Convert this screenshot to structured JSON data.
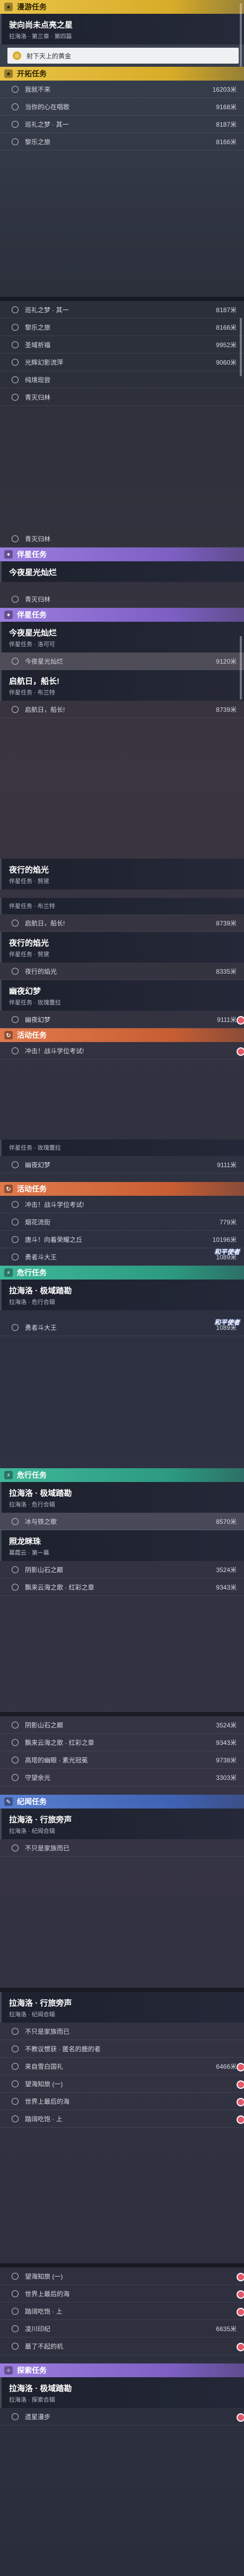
{
  "shot1": {
    "hdr1": "漫游任务",
    "card": {
      "title": "驶向尚未点亮之星",
      "sub": "拉海洛 · 第三章 · 第四篇"
    },
    "gold": "射下天上的黄金",
    "hdr2": "开拓任务",
    "rows": [
      {
        "name": "我就不来",
        "dist": "16203米"
      },
      {
        "name": "当你的心在唱歌",
        "dist": "9168米"
      },
      {
        "name": "巡礼之梦 · 其一",
        "dist": "8187米"
      },
      {
        "name": "黎乐之旅",
        "dist": "8166米"
      }
    ]
  },
  "shot2": {
    "rows": [
      {
        "name": "巡礼之梦 · 其一",
        "dist": "8187米"
      },
      {
        "name": "黎乐之旅",
        "dist": "8166米"
      },
      {
        "name": "圣域祈福",
        "dist": "9952米"
      },
      {
        "name": "光辉幻影流萍",
        "dist": "9060米"
      },
      {
        "name": "纯境现尝",
        "dist": ""
      },
      {
        "name": "青灭归林",
        "dist": ""
      }
    ]
  },
  "shot3": {
    "rows": [
      {
        "name": "青灭归林",
        "dist": ""
      }
    ],
    "hdr": "伴星任务",
    "card": {
      "title": "今夜星光灿烂",
      "sub": ""
    },
    "rows2": [
      {
        "name": "青灭归林",
        "dist": ""
      }
    ],
    "hdr2": "伴星任务",
    "card2": {
      "title": "今夜星光灿烂",
      "sub": "伴星任务 · 洛可可"
    },
    "row3": {
      "name": "今夜星光灿烂",
      "dist": "9120米"
    },
    "card3": {
      "title": "启航日，船长!",
      "sub": "伴星任务 · 布兰特"
    },
    "row4": {
      "name": "启航日，船长!",
      "dist": "8739米"
    }
  },
  "shot4": {
    "card1": {
      "title": "夜行的焰光",
      "sub": "伴星任务 · 努黛"
    },
    "sub2": "伴星任务 · 布兰特",
    "row1": {
      "name": "启航日，船长!",
      "dist": "8739米"
    },
    "card2": {
      "title": "夜行的焰光",
      "sub": "伴星任务 · 努黛"
    },
    "row2": {
      "name": "夜行的焰光",
      "dist": "8335米"
    },
    "card3": {
      "title": "幽夜幻梦",
      "sub": "伴星任务 · 玫瑰蕾拉"
    },
    "row3": {
      "name": "幽夜幻梦",
      "dist": "9111米"
    },
    "hdr": "活动任务",
    "row4": {
      "name": "冲击！战斗学位考试!",
      "dist": ""
    }
  },
  "shot5": {
    "sub": "伴星任务 · 玫瑰蕾拉",
    "row1": {
      "name": "幽夜幻梦",
      "dist": "9111米"
    },
    "hdr": "活动任务",
    "rows": [
      {
        "name": "冲击！战斗学位考试!",
        "dist": ""
      },
      {
        "name": "烟花流街",
        "dist": "779米"
      },
      {
        "name": "唐斗！向着荣耀之丘",
        "dist": "10196米"
      },
      {
        "name": "勇者斗大王",
        "dist": "1089米"
      }
    ],
    "logo": "和平使者",
    "hdr2": "危行任务",
    "card": {
      "title": "拉海洛 · 极域踏勘",
      "sub": "拉海洛 · 危行合辑"
    },
    "row5": {
      "name": "勇者斗大王",
      "dist": "1089米"
    },
    "logo2": "和平使者"
  },
  "shot6": {
    "hdr": "危行任务",
    "card": {
      "title": "拉海洛 · 极域踏勘",
      "sub": "拉海洛 · 危行合辑"
    },
    "row1": {
      "name": "冰与铁之歌",
      "dist": "8570米"
    },
    "card2": {
      "title": "照龙眯珠",
      "sub": "幕霞云 · 第一幕"
    },
    "rows": [
      {
        "name": "阴影山石之巅",
        "dist": "3524米"
      },
      {
        "name": "飘来云海之歌 · 红彩之章",
        "dist": "9343米"
      }
    ]
  },
  "shot7": {
    "rows": [
      {
        "name": "阴影山石之巅",
        "dist": "3524米"
      },
      {
        "name": "飘来云海之歌 · 红彩之章",
        "dist": "9343米"
      },
      {
        "name": "高塔的幽眼 · 素光冠冕",
        "dist": "9738米"
      },
      {
        "name": "守望余光",
        "dist": "3303米"
      }
    ],
    "hdr": "纪闻任务",
    "card": {
      "title": "拉海洛 · 行旅旁声",
      "sub": "拉海洛 · 纪闻合辑"
    },
    "rows2": [
      {
        "name": "不只是家族而已",
        "dist": ""
      }
    ]
  },
  "shot8": {
    "card": {
      "title": "拉海洛 · 行旅旁声",
      "sub": "拉海洛 · 纪闻合辑"
    },
    "rows": [
      {
        "name": "不只是家族而已",
        "dist": ""
      },
      {
        "name": "不教议惯获 · 匿名的鹿的者",
        "dist": ""
      },
      {
        "name": "来自雪白国礼",
        "dist": "6466米"
      },
      {
        "name": "望海知旅 (一)",
        "dist": ""
      },
      {
        "name": "世界上最后的海",
        "dist": ""
      },
      {
        "name": "踏阔吃饱 · 上",
        "dist": ""
      }
    ]
  },
  "shot9": {
    "rows": [
      {
        "name": "望海知旅 (一)",
        "dist": ""
      },
      {
        "name": "世界上最后的海",
        "dist": ""
      },
      {
        "name": "踏阔吃饱 · 上",
        "dist": ""
      },
      {
        "name": "凌川印纪",
        "dist": "6635米"
      },
      {
        "name": "最了不起的机",
        "dist": ""
      }
    ],
    "hdr": "探索任务",
    "card": {
      "title": "拉海洛 · 极域踏勘",
      "sub": "拉海洛 · 探索合辑"
    },
    "row": {
      "name": "遗星漫步",
      "dist": ""
    }
  }
}
